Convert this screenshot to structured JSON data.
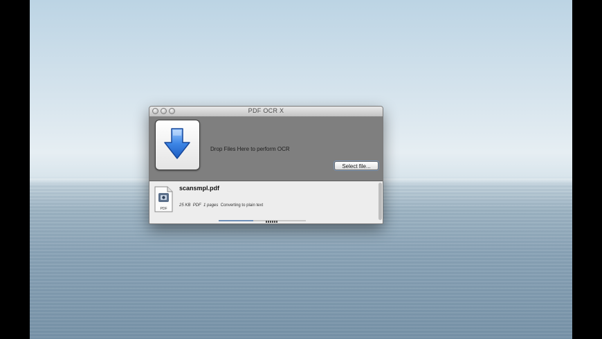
{
  "window": {
    "title": "PDF OCR X"
  },
  "drop_zone": {
    "instruction": "Drop Files Here to perform OCR",
    "select_button": "Select file...",
    "arrow_icon": "down-arrow-icon",
    "arrow_color": "#2f74d8"
  },
  "files": [
    {
      "name": "scansmpl.pdf",
      "size": "25 KB",
      "type": "PDF",
      "pages": "1 pages",
      "status": "Converting to plain text",
      "icon": "pdf-file-icon",
      "icon_label": "PDF",
      "progress": 0.4
    }
  ]
}
